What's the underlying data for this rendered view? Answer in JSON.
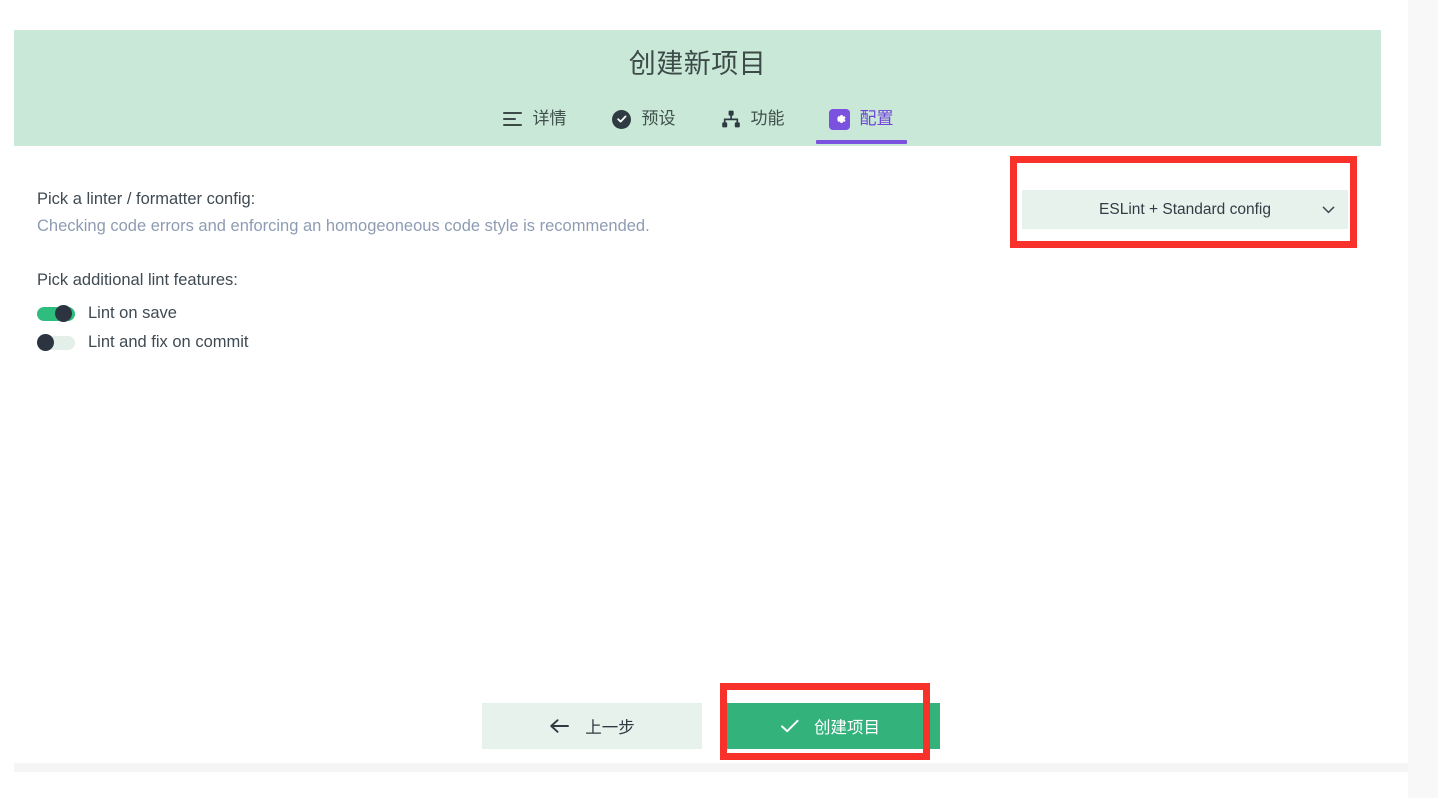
{
  "window": {
    "title": "创建新项目"
  },
  "header": {
    "title": "创建新项目",
    "tabs": [
      {
        "label": "详情",
        "icon": "lines-icon",
        "active": false
      },
      {
        "label": "预设",
        "icon": "check-circle-icon",
        "active": false
      },
      {
        "label": "功能",
        "icon": "sitemap-icon",
        "active": false
      },
      {
        "label": "配置",
        "icon": "gear-icon",
        "active": true
      }
    ]
  },
  "main": {
    "linter": {
      "label": "Pick a linter / formatter config:",
      "hint": "Checking code errors and enforcing an homogeoneous code style is recommended.",
      "select": {
        "value": "ESLint + Standard config",
        "chevron": "chevron-down-icon"
      }
    },
    "lint_features": {
      "heading": "Pick additional lint features:",
      "toggles": [
        {
          "label": "Lint on save",
          "on": true
        },
        {
          "label": "Lint and fix on commit",
          "on": false
        }
      ]
    }
  },
  "footer": {
    "back_button": {
      "label": "上一步",
      "icon": "arrow-left-icon"
    },
    "create_button": {
      "label": "创建项目",
      "icon": "check-icon"
    }
  },
  "colors": {
    "header_background": "#c9e8d8",
    "accent_purple": "#7b52e0",
    "toggle_on": "#2fbd7e",
    "create_button": "#33b27c",
    "select_background": "#e7f2ec",
    "annotation_red": "#f8312b",
    "hint_text": "#8e9cb3"
  }
}
